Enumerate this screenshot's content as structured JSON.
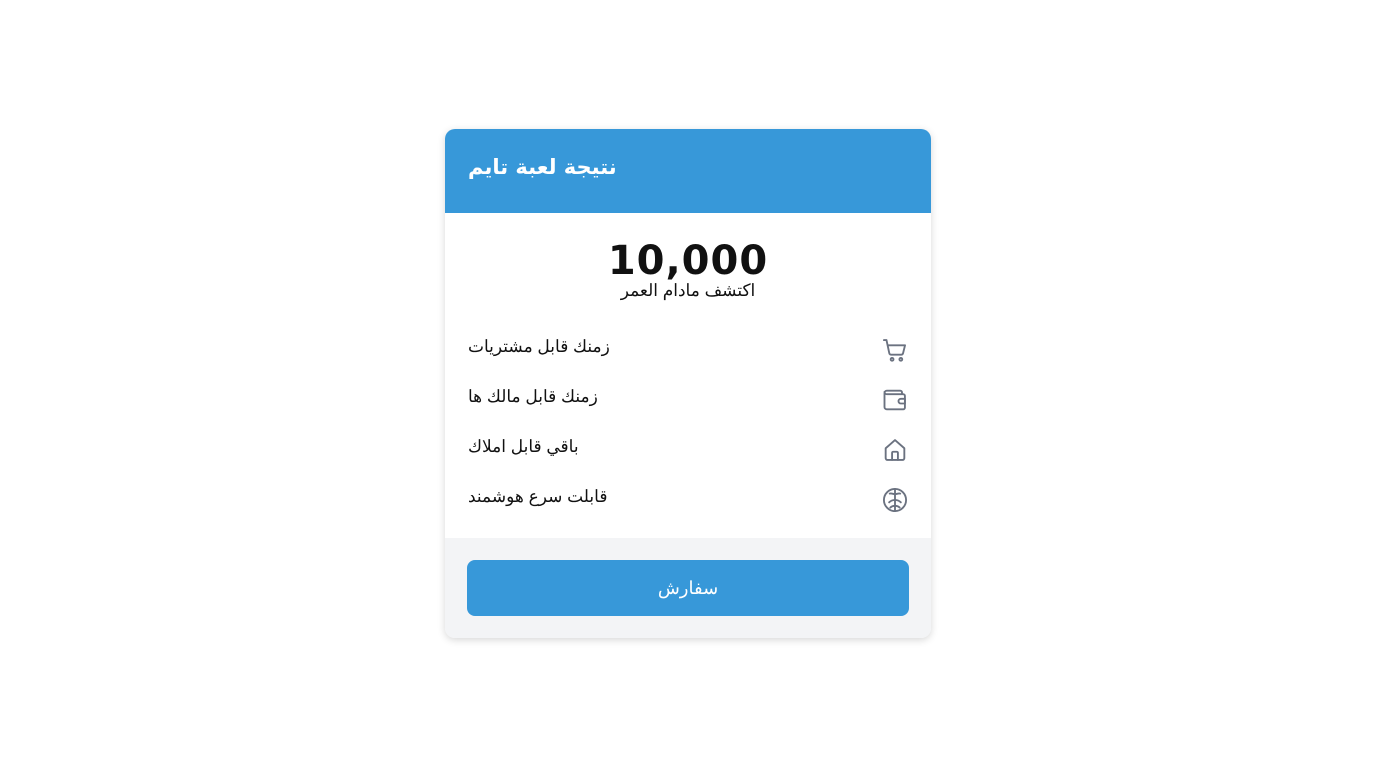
{
  "card": {
    "title": "نتيجة لعبة تايم",
    "score": "10,000",
    "subtitle": "اكتشف مادام العمر"
  },
  "features": [
    {
      "label": "زمنك قابل مشتريات",
      "icon": "shopping-cart-icon"
    },
    {
      "label": "زمنك قابل مالك ها",
      "icon": "wallet-icon"
    },
    {
      "label": "باقي قابل املاك",
      "icon": "home-icon"
    },
    {
      "label": "قابلت سرع هوشمند",
      "icon": "brain-icon"
    }
  ],
  "footer": {
    "button_label": "سفارش"
  },
  "colors": {
    "accent": "#3798d9",
    "icon": "#6b7280",
    "footer_bg": "#f3f4f6"
  }
}
